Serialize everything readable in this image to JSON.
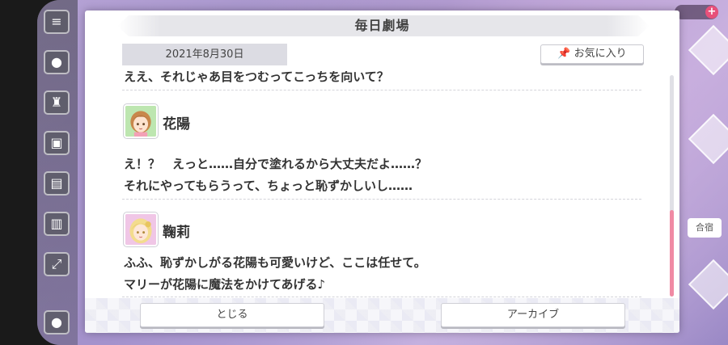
{
  "dialog": {
    "title": "毎日劇場",
    "date": "2021年8月30日",
    "favorite_label": "お気に入り"
  },
  "messages": {
    "cut_line": "ええ、それじゃあ目をつむってこっちを向いて？",
    "blocks": [
      {
        "speaker": "花陽",
        "lines": [
          "え！？　えっと……自分で塗れるから大丈夫だよ……？",
          "それにやってもらうって、ちょっと恥ずかしいし……"
        ]
      },
      {
        "speaker": "鞠莉",
        "lines": [
          "ふふ、恥ずかしがる花陽も可愛いけど、ここは任せて。",
          "マリーが花陽に魔法をかけてあげる♪"
        ]
      }
    ]
  },
  "footer": {
    "close_label": "とじる",
    "archive_label": "アーカイブ"
  },
  "background": {
    "side_label": "合宿"
  },
  "colors": {
    "scroll_thumb": "#f08aa4",
    "header_band": "#e6e6ea",
    "date_tab": "#dcdce3"
  }
}
